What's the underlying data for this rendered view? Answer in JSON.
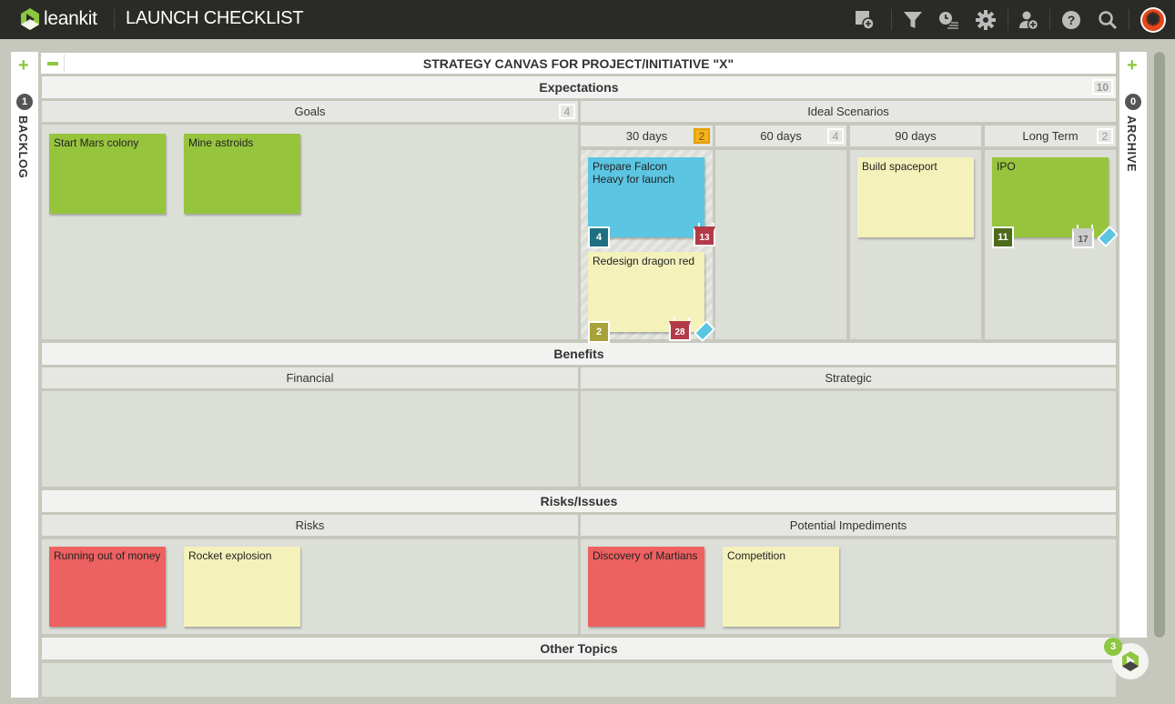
{
  "app": {
    "brand": "leankit",
    "board_title": "LAUNCH CHECKLIST"
  },
  "toolbar": {
    "icons": [
      "add-card-icon",
      "filter-icon",
      "timeline-icon",
      "settings-icon",
      "add-user-icon",
      "help-icon",
      "search-icon",
      "user-avatar"
    ]
  },
  "backlog": {
    "label": "BACKLOG",
    "count": "1"
  },
  "archive": {
    "label": "ARCHIVE",
    "count": "0"
  },
  "canvas": {
    "title": "STRATEGY CANVAS FOR PROJECT/INITIATIVE \"X\""
  },
  "lanes": {
    "expectations": {
      "title": "Expectations",
      "wip": "10"
    },
    "goals": {
      "title": "Goals",
      "wip": "4"
    },
    "ideal": {
      "title": "Ideal Scenarios"
    },
    "d30": {
      "title": "30 days",
      "wip": "2"
    },
    "d60": {
      "title": "60 days",
      "wip": "4"
    },
    "d90": {
      "title": "90 days"
    },
    "longterm": {
      "title": "Long Term",
      "wip": "2"
    },
    "benefits": {
      "title": "Benefits"
    },
    "financial": {
      "title": "Financial"
    },
    "strategic": {
      "title": "Strategic"
    },
    "risksissues": {
      "title": "Risks/Issues"
    },
    "risks": {
      "title": "Risks"
    },
    "impediments": {
      "title": "Potential Impediments"
    },
    "other": {
      "title": "Other Topics"
    }
  },
  "cards": {
    "mars": {
      "title": "Start Mars colony",
      "color": "#97c43d"
    },
    "astroids": {
      "title": "Mine astroids",
      "color": "#97c43d"
    },
    "falcon": {
      "title": "Prepare Falcon Heavy for launch",
      "size": "4",
      "due": "13",
      "color": "#5bc5e2"
    },
    "dragon": {
      "title": "Redesign dragon red",
      "size": "2",
      "due": "28",
      "color": "#f4f1bb"
    },
    "spaceport": {
      "title": "Build spaceport",
      "color": "#f4f1bb"
    },
    "ipo": {
      "title": "IPO",
      "size": "11",
      "due": "17",
      "color": "#97c43d"
    },
    "money": {
      "title": "Running out of money",
      "color": "#ee6161"
    },
    "explosion": {
      "title": "Rocket explosion",
      "color": "#f4f1bb"
    },
    "martians": {
      "title": "Discovery of Martians",
      "color": "#ee6161"
    },
    "competition": {
      "title": "Competition",
      "color": "#f4f1bb"
    }
  },
  "notifications": {
    "count": "3"
  }
}
